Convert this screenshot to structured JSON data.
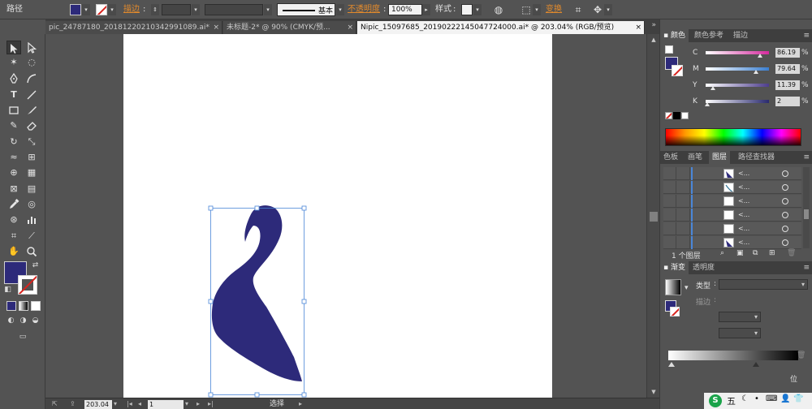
{
  "control_bar": {
    "mode": "路径",
    "stroke_label": "描边",
    "stroke_profile": "基本",
    "opacity_label": "不透明度",
    "opacity_value": "100%",
    "style_label": "样式",
    "transform_label": "变换"
  },
  "tabs": [
    {
      "label": "pic_24787180_20181220210342991089.ai*",
      "active": false
    },
    {
      "label": "未标题-2* @ 90% (CMYK/预...",
      "active": false
    },
    {
      "label": "Nipic_15097685_20190222145047724000.ai* @ 203.04% (RGB/预览)",
      "active": true
    }
  ],
  "tabs_close": "×",
  "tabs_overflow": "»",
  "status": {
    "zoom": "203.04",
    "page": "1",
    "tool": "选择"
  },
  "color_panel": {
    "tabs": [
      "颜色",
      "颜色参考",
      "描边"
    ],
    "sliders": [
      {
        "letter": "C",
        "value": "86.19",
        "level": 0.86,
        "track": "#d62a9e"
      },
      {
        "letter": "M",
        "value": "79.64",
        "level": 0.8,
        "track": "#3b7fd0"
      },
      {
        "letter": "Y",
        "value": "11.39",
        "level": 0.11,
        "track": "#4d3d8c"
      },
      {
        "letter": "K",
        "value": "2",
        "level": 0.02,
        "track": "#2a2a6e"
      }
    ],
    "unit": "%"
  },
  "layers_panel": {
    "tabs": [
      "色板",
      "画笔",
      "图层",
      "路径查找器"
    ],
    "rows": [
      {
        "name": "<...",
        "thumb": "swan"
      },
      {
        "name": "<...",
        "thumb": "line"
      },
      {
        "name": "<...",
        "thumb": "blank"
      },
      {
        "name": "<...",
        "thumb": "blank"
      },
      {
        "name": "<...",
        "thumb": "blank"
      },
      {
        "name": "<...",
        "thumb": "swan"
      }
    ],
    "count_label": "1 个图层"
  },
  "gradient_panel": {
    "tabs": [
      "渐变",
      "透明度"
    ],
    "type_label": "类型",
    "stroke_label": "描边",
    "position_label": "位"
  },
  "taskbar": {
    "ime": "五"
  },
  "colors": {
    "fill": "#2d2a7a",
    "selection": "#4a86d8"
  }
}
